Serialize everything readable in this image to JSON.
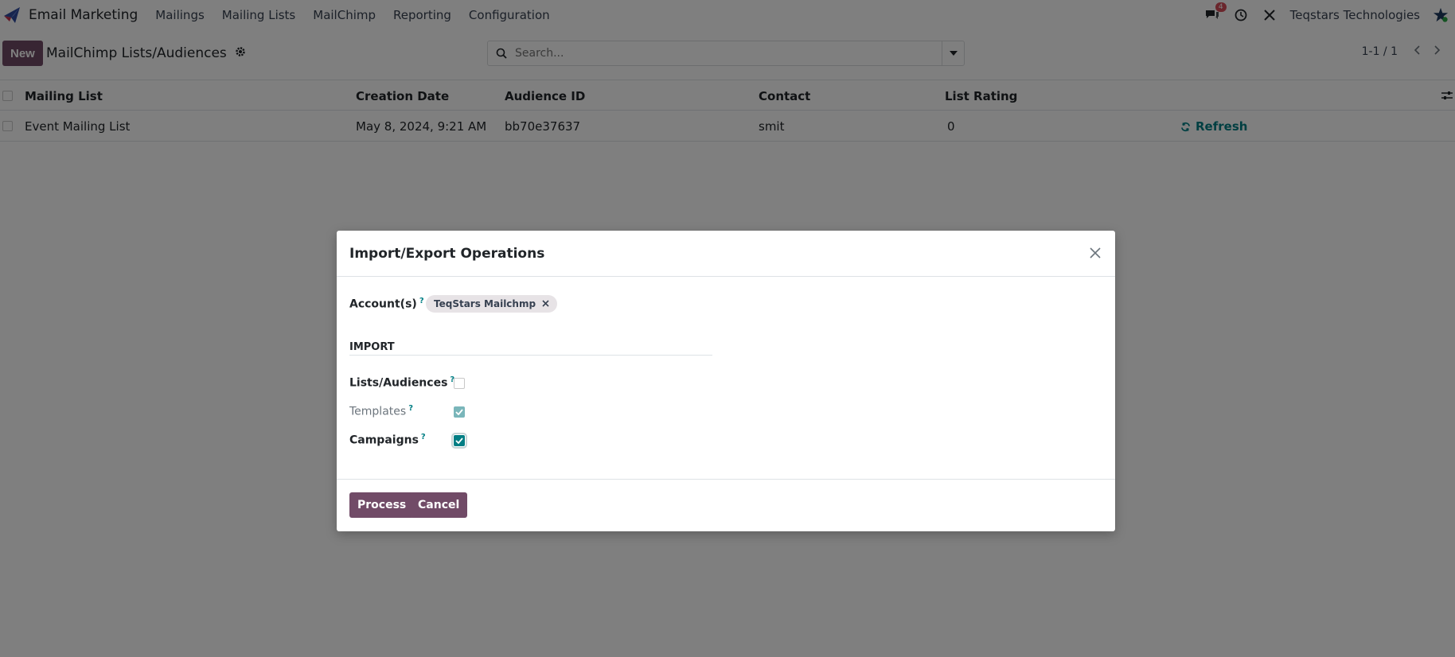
{
  "app": {
    "name": "Email Marketing"
  },
  "nav": {
    "menu": [
      "Mailings",
      "Mailing Lists",
      "MailChimp",
      "Reporting",
      "Configuration"
    ],
    "messages_badge": "4",
    "company": "Teqstars Technologies"
  },
  "control": {
    "new_label": "New",
    "breadcrumb": "MailChimp Lists/Audiences",
    "search_placeholder": "Search...",
    "pager": "1-1 / 1"
  },
  "table": {
    "columns": [
      "Mailing List",
      "Creation Date",
      "Audience ID",
      "Contact",
      "List Rating"
    ],
    "rows": [
      {
        "mailing_list": "Event Mailing List",
        "creation_date": "May 8, 2024, 9:21 AM",
        "audience_id": "bb70e37637",
        "contact": "smit",
        "list_rating": "0",
        "action": "Refresh"
      }
    ]
  },
  "modal": {
    "title": "Import/Export Operations",
    "account_label": "Account(s)",
    "account_tag": "TeqStars Mailchmp",
    "help_mark": "?",
    "section": "IMPORT",
    "options": [
      {
        "label": "Lists/Audiences",
        "checked": false,
        "readonly": false
      },
      {
        "label": "Templates",
        "checked": true,
        "readonly": true
      },
      {
        "label": "Campaigns",
        "checked": true,
        "readonly": false
      }
    ],
    "process_label": "Process",
    "cancel_label": "Cancel"
  },
  "colors": {
    "brand": "#714b67",
    "accent": "#017e84",
    "badge": "#d44c59"
  }
}
